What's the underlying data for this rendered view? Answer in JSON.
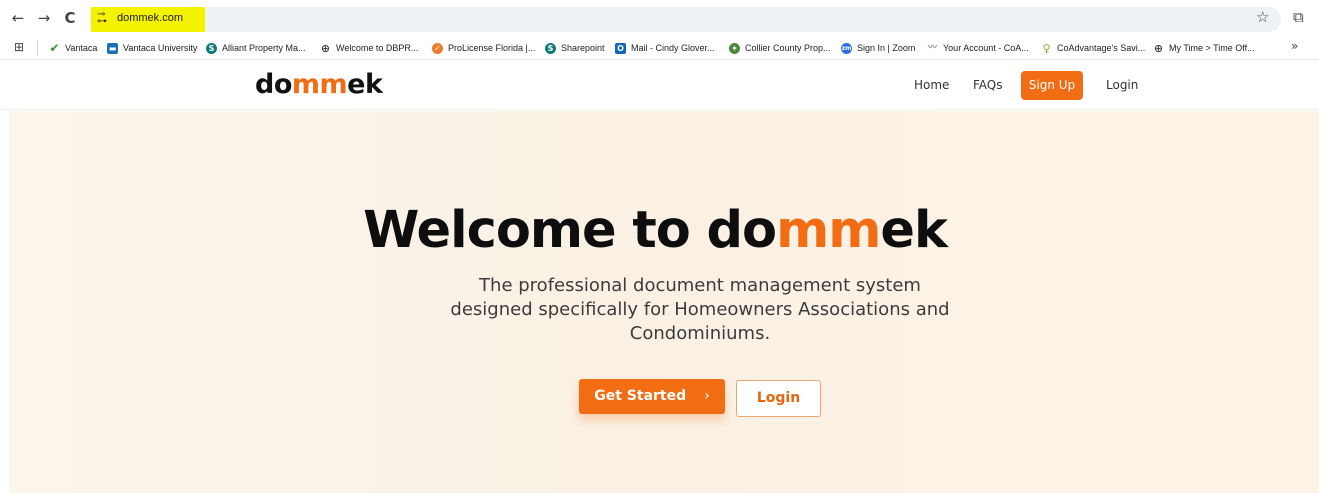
{
  "browser": {
    "url": "dommek.com",
    "back_icon": "←",
    "forward_icon": "→",
    "reload_icon": "C",
    "bookmarks": [
      {
        "label": "Vantaca",
        "icon": "vantaca-icon",
        "color": "#2e9a3a"
      },
      {
        "label": "Vantaca University",
        "icon": "vantaca-university-icon",
        "color": "#1b6fb4"
      },
      {
        "label": "Alliant Property Ma...",
        "icon": "sharepoint-icon",
        "color": "#0d7a7a"
      },
      {
        "label": "Welcome to DBPR...",
        "icon": "globe-icon",
        "color": "#444444"
      },
      {
        "label": "ProLicense Florida |...",
        "icon": "prolicense-icon",
        "color": "#f07b2c"
      },
      {
        "label": "Sharepoint",
        "icon": "sharepoint-icon",
        "color": "#0d7a7a"
      },
      {
        "label": "Mail - Cindy Glover...",
        "icon": "outlook-icon",
        "color": "#1565c0"
      },
      {
        "label": "Collier County Prop...",
        "icon": "collier-icon",
        "color": "#4a8a3a"
      },
      {
        "label": "Sign In | Zoom",
        "icon": "zoom-icon",
        "color": "#2d6cdf"
      },
      {
        "label": "Your Account - CoA...",
        "icon": "coa-icon",
        "color": "#999999"
      },
      {
        "label": "CoAdvantage's Savi...",
        "icon": "lightbulb-icon",
        "color": "#7cb342"
      },
      {
        "label": "My Time > Time Off...",
        "icon": "globe-icon",
        "color": "#444444"
      }
    ]
  },
  "site": {
    "logo_prefix": "do",
    "logo_mm": "mm",
    "logo_suffix": "ek",
    "nav": {
      "home": "Home",
      "faqs": "FAQs",
      "signup": "Sign Up",
      "login": "Login"
    },
    "hero": {
      "title_prefix": "Welcome to ",
      "subtitle_line1": "The professional document management system",
      "subtitle_line2": "designed specifically for Homeowners Associations and",
      "subtitle_line3": "Condominiums.",
      "get_started": "Get Started",
      "get_started_chevron": "›",
      "login": "Login"
    }
  },
  "colors": {
    "brand_orange": "#f26c13",
    "url_highlight": "#f5f200"
  }
}
